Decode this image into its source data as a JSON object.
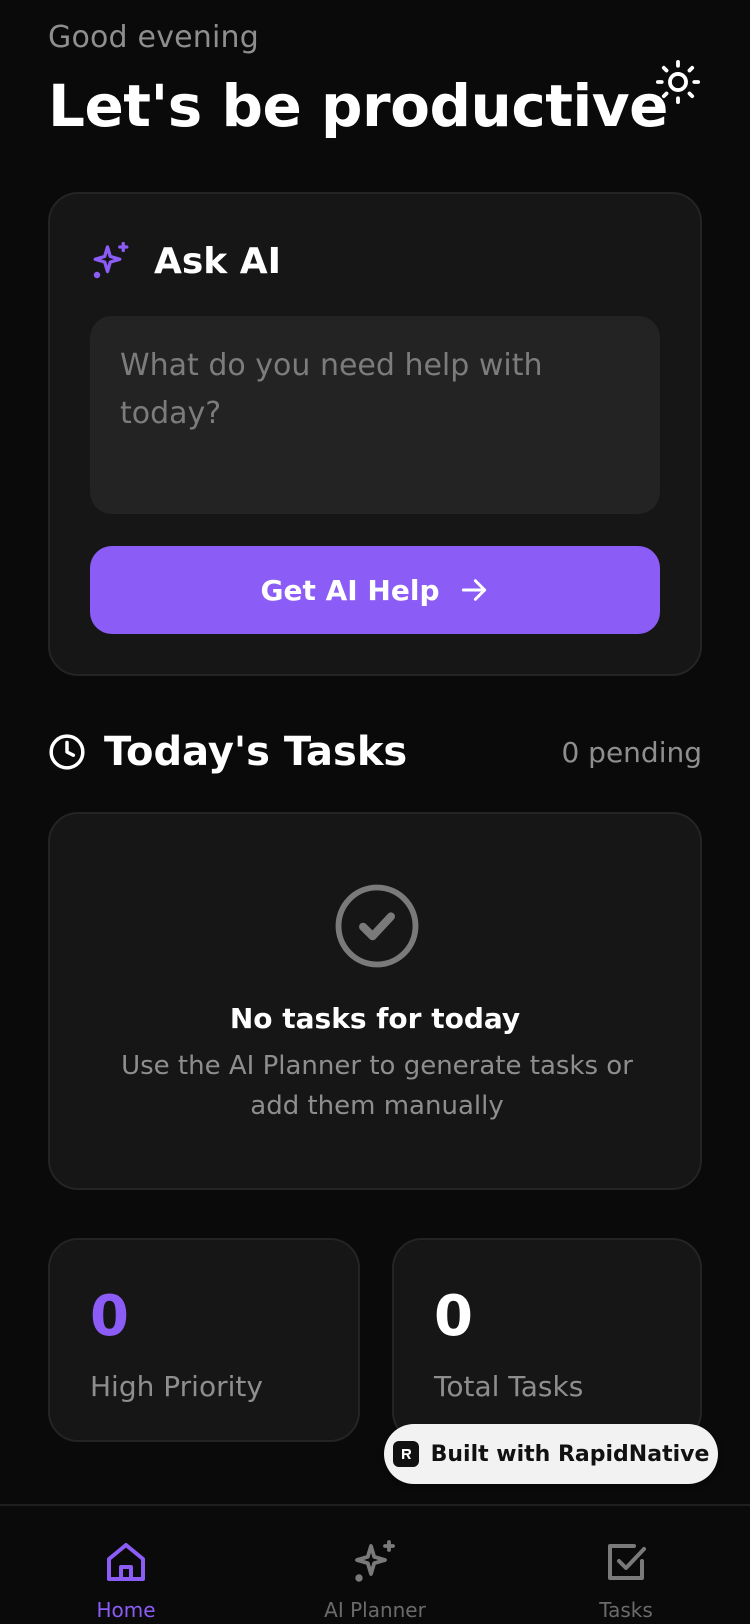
{
  "header": {
    "greeting": "Good evening",
    "title": "Let's be productive",
    "theme_icon": "sun-icon"
  },
  "ask_ai": {
    "title": "Ask AI",
    "icon": "sparkles-icon",
    "input_value": "",
    "input_placeholder": "What do you need help with today?",
    "button_label": "Get AI Help",
    "button_icon": "arrow-right-icon"
  },
  "tasks": {
    "title": "Today's Tasks",
    "icon": "clock-icon",
    "pending_label": "0 pending",
    "empty_title": "No tasks for today",
    "empty_subtitle": "Use the AI Planner to generate tasks or add them manually"
  },
  "stats": {
    "high_priority_value": "0",
    "high_priority_label": "High Priority",
    "total_tasks_value": "0",
    "total_tasks_label": "Total Tasks"
  },
  "badge": {
    "label": "Built with RapidNative"
  },
  "nav": {
    "items": [
      {
        "label": "Home",
        "icon": "home-icon",
        "active": true
      },
      {
        "label": "AI Planner",
        "icon": "sparkles-icon",
        "active": false
      },
      {
        "label": "Tasks",
        "icon": "checkbox-icon",
        "active": false
      }
    ]
  },
  "colors": {
    "accent": "#8b5cf6",
    "background": "#0a0a0a",
    "card": "#161616",
    "muted_text": "#8e8e8e"
  }
}
